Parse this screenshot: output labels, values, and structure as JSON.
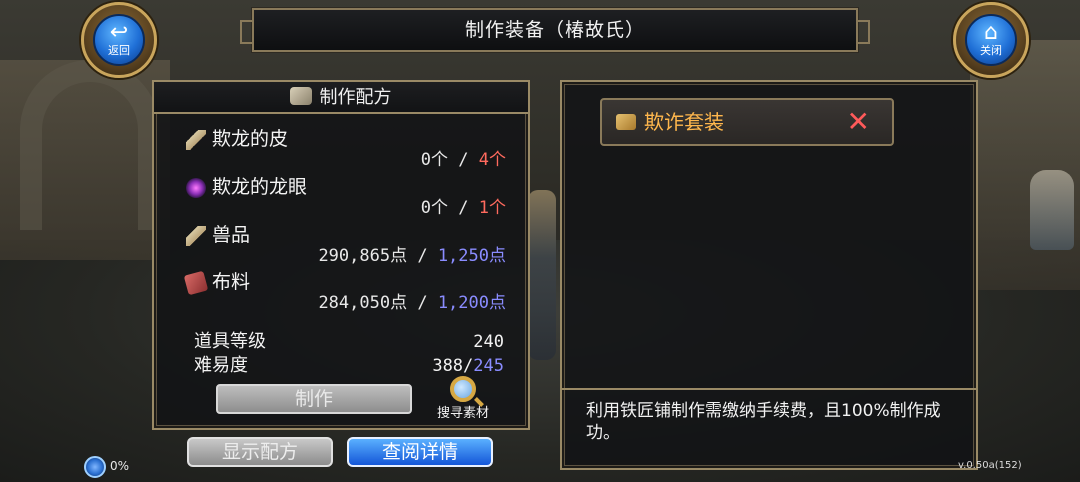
{
  "window": {
    "title": "制作装备（椿故氏）"
  },
  "nav": {
    "back": {
      "label": "返回",
      "icon": "back-arrow-icon"
    },
    "close": {
      "label": "关闭",
      "icon": "home-icon"
    }
  },
  "recipe_panel": {
    "header": "制作配方",
    "materials": [
      {
        "name": "欺龙的皮",
        "have": "0个",
        "need": "4个",
        "need_color": "#ff6a5e",
        "icon": "feather-icon"
      },
      {
        "name": "欺龙的龙眼",
        "have": "0个",
        "need": "1个",
        "need_color": "#ff6a5e",
        "icon": "eye-orb-icon"
      },
      {
        "name": "兽品",
        "have": "290,865点",
        "need": "1,250点",
        "need_color": "#8a8cff",
        "icon": "feather-icon"
      },
      {
        "name": "布料",
        "have": "284,050点",
        "need": "1,200点",
        "need_color": "#8a8cff",
        "icon": "cloth-icon"
      }
    ],
    "separator": " / ",
    "item_level": {
      "label": "道具等级",
      "value": "240"
    },
    "difficulty": {
      "label": "难易度",
      "current": "388/",
      "max": "245"
    },
    "make_button": "制作",
    "search_label": "搜寻素材"
  },
  "bottom_buttons": {
    "show_recipe": "显示配方",
    "view_details": "查阅详情"
  },
  "set_panel": {
    "set_name": "欺诈套装",
    "remove_symbol": "✕",
    "notice": "利用铁匠铺制作需缴纳手续费，且100%制作成功。"
  },
  "status": {
    "percent": "0%",
    "version": "v.0.50a(152)"
  },
  "colors": {
    "frame_gold": "#9a8a66",
    "need_red": "#ff6a5e",
    "need_blue": "#8a8cff",
    "set_name_orange": "#ffb74d"
  }
}
